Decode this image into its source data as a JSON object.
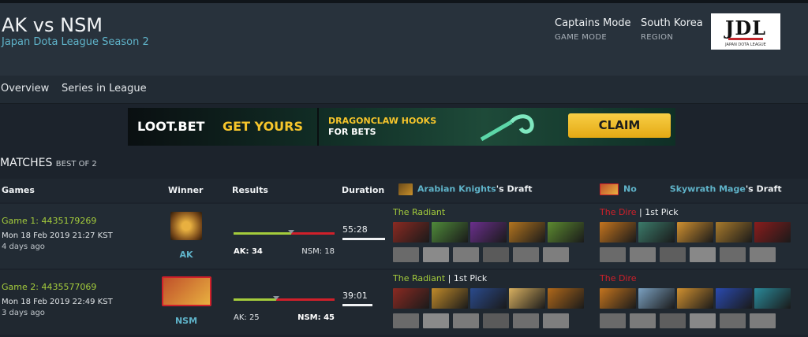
{
  "match": {
    "title": "AK vs NSM",
    "league": "Japan Dota League Season 2",
    "game_mode_value": "Captains Mode",
    "game_mode_label": "GAME MODE",
    "region_value": "South Korea",
    "region_label": "REGION",
    "league_logo": "JDL",
    "league_logo_sub": "JAPAN DOTA LEAGUE"
  },
  "nav": {
    "overview": "Overview",
    "series": "Series in League"
  },
  "banner": {
    "brand": "LOOT.BET",
    "slogan": "GET YOURS",
    "promo_line1": "DRAGONCLAW HOOKS",
    "promo_line2": "FOR BETS",
    "claim": "CLAIM"
  },
  "section": {
    "title": "MATCHES",
    "subtitle": "BEST OF 2"
  },
  "columns": {
    "games": "Games",
    "winner": "Winner",
    "results": "Results",
    "duration": "Duration",
    "draft1_team": "Arabian Knights",
    "draft1_suffix": "'s Draft",
    "draft2_prefix": "No",
    "draft2_team": "Skywrath Mage",
    "draft2_suffix": "'s Draft"
  },
  "games": [
    {
      "link": "Game 1: 4435179269",
      "date": "Mon 18 Feb 2019 21:27 KST",
      "ago": "4 days ago",
      "winner": "AK",
      "left_score": "AK: 34",
      "right_score": "NSM: 18",
      "radiant_share": 0.57,
      "duration": "55:28",
      "duration_share": 1.0,
      "left_side": "The Radiant",
      "left_extra": "",
      "right_side": "The Dire",
      "right_extra": "1st Pick"
    },
    {
      "link": "Game 2: 4435577069",
      "date": "Mon 18 Feb 2019 22:49 KST",
      "ago": "3 days ago",
      "winner": "NSM",
      "left_score": "AK: 25",
      "right_score": "NSM: 45",
      "radiant_share": 0.42,
      "duration": "39:01",
      "duration_share": 0.7,
      "left_side": "The Radiant",
      "left_extra": "1st Pick",
      "right_side": "The Dire",
      "right_extra": ""
    }
  ],
  "hero_colors": {
    "g1_left_picks": [
      "#8a2a22",
      "#4f8a3a",
      "#6a2f8c",
      "#b2741f",
      "#5c8a30"
    ],
    "g1_right_picks": [
      "#c4741e",
      "#3b7a6a",
      "#d09030",
      "#a87a2c",
      "#8a1c1c"
    ],
    "g2_left_picks": [
      "#8a2a22",
      "#c08a2a",
      "#2a4a8c",
      "#d8b060",
      "#b0681a"
    ],
    "g2_right_picks": [
      "#c4741e",
      "#7aa0c0",
      "#d09030",
      "#2a4ab0",
      "#2a8a9a"
    ]
  }
}
